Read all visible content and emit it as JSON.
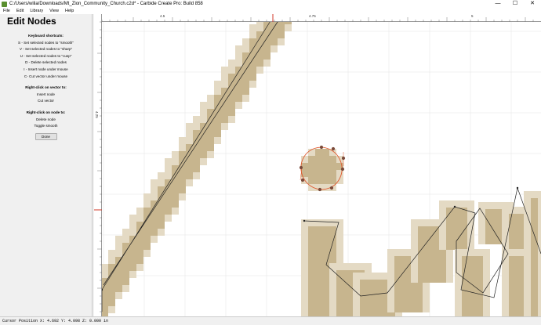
{
  "window": {
    "title": "C:/Users/wilia/Downloads/Mt_Zion_Community_Church.c2d* - Carbide Create Pro: Build 858",
    "minimize": "—",
    "maximize": "☐",
    "close": "✕"
  },
  "menu": [
    "File",
    "Edit",
    "Library",
    "View",
    "Help"
  ],
  "panel": {
    "heading": "Edit Nodes",
    "shortcuts_heading": "Keyboard shortcuts:",
    "shortcuts": [
      "S - Set selected nodes to \"smooth\"",
      "V - Set selected nodes to \"sharp\"",
      "U - Set selected nodes to \"cusp\"",
      "D - Delete selected nodes",
      "I - Insert node under mouse",
      "C- Cut vector under mouse"
    ],
    "vector_heading": "Right-click on vector to:",
    "vector_actions": [
      "Insert node",
      "Cut vector"
    ],
    "node_heading": "Right-click on node to:",
    "node_actions": [
      "Delete node",
      "Toggle smooth"
    ],
    "done_label": "Done"
  },
  "ruler": {
    "top_labels": [
      "4.5",
      "4.75",
      "5"
    ],
    "left_label": "4.25"
  },
  "status": {
    "text": "Cursor Position X: 4.692 Y: 4.098 Z: 0.000 in"
  },
  "colors": {
    "pixel_fill": "#c7b58e",
    "pixel_light": "#e4dac4",
    "selected_curve": "#e0592f",
    "node": "#7a4a3a",
    "grid": "#e6e6e6",
    "ruler_marker": "#d03a2a"
  }
}
